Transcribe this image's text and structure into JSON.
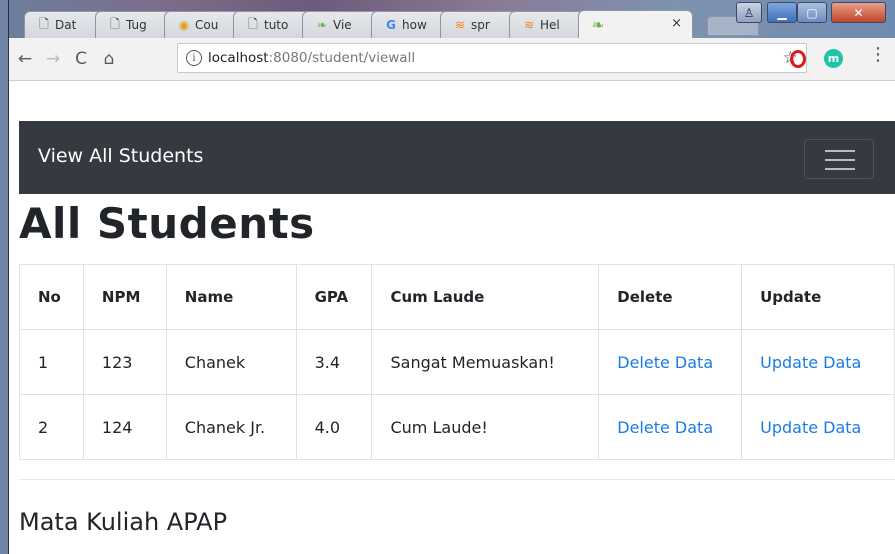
{
  "browser": {
    "tabs": [
      {
        "icon": "page-icon",
        "label": "Dat"
      },
      {
        "icon": "page-icon",
        "label": "Tug"
      },
      {
        "icon": "course-icon",
        "label": "Cou"
      },
      {
        "icon": "page-icon",
        "label": "tuto"
      },
      {
        "icon": "leaf-icon",
        "label": "Vie"
      },
      {
        "icon": "google-icon",
        "label": "how"
      },
      {
        "icon": "stack-icon",
        "label": "spr"
      },
      {
        "icon": "stack-icon",
        "label": "Hel"
      },
      {
        "icon": "leaf-icon",
        "label": ""
      }
    ],
    "active_tab_close": "×",
    "url_host": "localhost",
    "url_rest": ":8080/student/viewall",
    "ext_m_label": "m"
  },
  "navbar": {
    "brand": "View All Students"
  },
  "page": {
    "title": "All Students",
    "subheading": "Mata Kuliah APAP"
  },
  "table": {
    "headers": [
      "No",
      "NPM",
      "Name",
      "GPA",
      "Cum Laude",
      "Delete",
      "Update"
    ],
    "rows": [
      {
        "no": "1",
        "npm": "123",
        "name": "Chanek",
        "gpa": "3.4",
        "cum_laude": "Sangat Memuaskan!",
        "delete": "Delete Data",
        "update": "Update Data"
      },
      {
        "no": "2",
        "npm": "124",
        "name": "Chanek Jr.",
        "gpa": "4.0",
        "cum_laude": "Cum Laude!",
        "delete": "Delete Data",
        "update": "Update Data"
      }
    ]
  },
  "colors": {
    "navbar_bg": "#343a40",
    "link": "#1a7ce6",
    "text": "#212529"
  }
}
